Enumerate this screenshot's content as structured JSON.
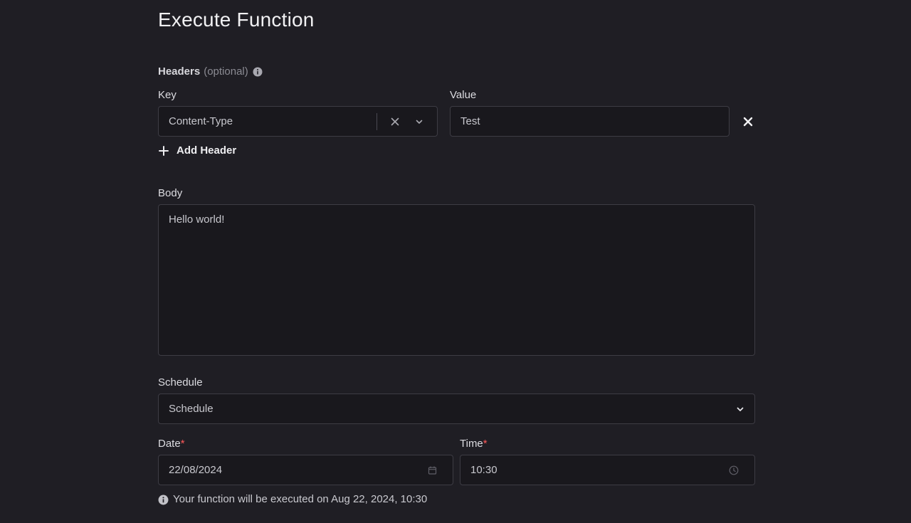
{
  "page": {
    "title": "Execute Function"
  },
  "headers": {
    "label": "Headers",
    "optional": "(optional)",
    "key_label": "Key",
    "value_label": "Value",
    "rows": [
      {
        "key": "Content-Type",
        "value": "Test"
      }
    ],
    "add_label": "Add Header"
  },
  "body": {
    "label": "Body",
    "value": "Hello world!"
  },
  "schedule": {
    "label": "Schedule",
    "selected": "Schedule"
  },
  "date": {
    "label": "Date",
    "required_mark": "*",
    "value": "22/08/2024"
  },
  "time": {
    "label": "Time",
    "required_mark": "*",
    "value": "10:30"
  },
  "hint": {
    "text": "Your function will be executed on Aug 22, 2024, 10:30"
  },
  "icons": {
    "info": "info-icon",
    "clear": "clear-icon",
    "chevron": "chevron-down-icon",
    "remove": "close-icon",
    "add": "plus-icon",
    "calendar": "calendar-icon",
    "clock": "clock-icon"
  },
  "colors": {
    "background": "#1f1e24",
    "input_bg": "#19181d",
    "border": "#3d3c44",
    "required": "#ff5a5a"
  }
}
